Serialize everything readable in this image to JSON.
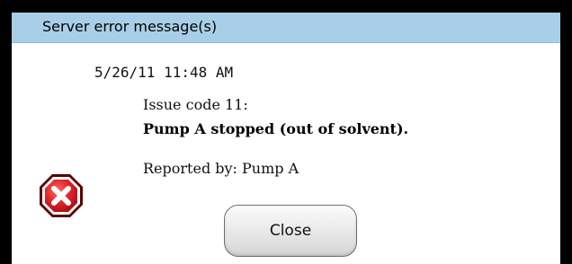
{
  "dialog": {
    "title": "Server error message(s)",
    "timestamp": "5/26/11 11:48 AM",
    "issue_code": "Issue code 11:",
    "issue_message": "Pump A stopped (out of solvent).",
    "reported_by": "Reported by: Pump A",
    "close_label": "Close",
    "icon": "error-icon"
  },
  "colors": {
    "titlebar": "#a9cfe8",
    "error_red": "#d7191f",
    "frame": "#000000",
    "background": "#ffffff"
  }
}
